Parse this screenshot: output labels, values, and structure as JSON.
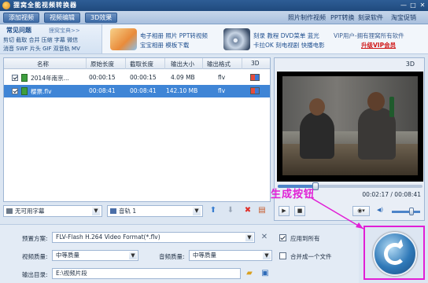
{
  "window": {
    "title": "狸窝全能视频转换器",
    "controls": [
      "—",
      "□",
      "✕"
    ]
  },
  "toolbar": {
    "buttons": [
      "添加视频",
      "视频编辑",
      "3D效果"
    ],
    "links": [
      "照片制作视频",
      "PPT转换",
      "刻录软件",
      "淘宝促销"
    ]
  },
  "banner": {
    "faq_title": "常见问题",
    "faq_more": "狸窝宝典>>",
    "faq_rows": [
      "剪切 截取 合并 压缩 字幕 微信",
      "消音 SWF 片头 GIF 双音轨 MV"
    ],
    "promo1": [
      "电子相册 照片 PPT转视频",
      "宝宝相册 模板下载"
    ],
    "promo2": [
      "刻录 教程 DVD菜单 蓝光",
      "卡拉OK 刻电视剧 快播电影"
    ],
    "vip_text": "VIP用户-拥有狸窝所有软件",
    "vip_link": "升级VIP会员"
  },
  "file_list": {
    "columns": [
      "名称",
      "原始长度",
      "截取长度",
      "输出大小",
      "输出格式",
      "3D"
    ],
    "rows": [
      {
        "name": "2014年南京...",
        "original": "00:00:15",
        "cut": "00:00:15",
        "size": "4.09 MB",
        "format": "flv",
        "selected": false
      },
      {
        "name": "樱票.flv",
        "original": "00:08:41",
        "cut": "00:08:41",
        "size": "142.10 MB",
        "format": "flv",
        "selected": true
      }
    ]
  },
  "list_tools": {
    "subtitle": "无可用字幕",
    "audio": "音轨 1"
  },
  "preview": {
    "label_3d": "3D",
    "current_time": "00:02:17",
    "total_time": "00:08:41",
    "time_display": "00:02:17 / 00:08:41",
    "progress": 0.263,
    "volume": 0.7
  },
  "settings": {
    "preset_label": "预置方案:",
    "preset_value": "FLV-Flash H.264 Video Format(*.flv)",
    "apply_all": "应用到所有",
    "video_quality_label": "视频质量:",
    "video_quality": "中等质量",
    "audio_quality_label": "音频质量:",
    "audio_quality": "中等质量",
    "merge_label": "合并成一个文件",
    "output_label": "输出目录:",
    "output_path": "E:\\视频片段"
  },
  "annotation": {
    "text": "生成按钮",
    "color": "#e11fd6"
  }
}
